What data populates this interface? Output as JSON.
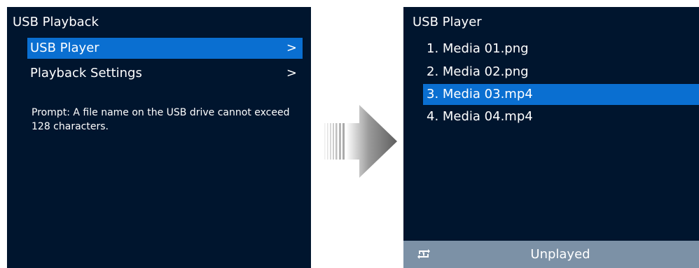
{
  "left_screen": {
    "title": "USB Playback",
    "menu": [
      {
        "label": "USB Player",
        "chevron": ">",
        "selected": true
      },
      {
        "label": "Playback Settings",
        "chevron": ">",
        "selected": false
      }
    ],
    "prompt": "Prompt: A file name on the USB drive cannot exceed 128 characters."
  },
  "right_screen": {
    "title": "USB Player",
    "files": [
      {
        "label": "1. Media 01.png",
        "selected": false
      },
      {
        "label": "2. Media 02.png",
        "selected": false
      },
      {
        "label": "3. Media 03.mp4",
        "selected": true
      },
      {
        "label": "4. Media 04.mp4",
        "selected": false
      }
    ],
    "status": {
      "icon": "repeat-one-icon",
      "text": "Unplayed"
    }
  },
  "colors": {
    "screen_bg": "#00152e",
    "highlight": "#0a6fd1",
    "status_bar": "#7c91a6",
    "arrow": "#6b6b6b"
  }
}
